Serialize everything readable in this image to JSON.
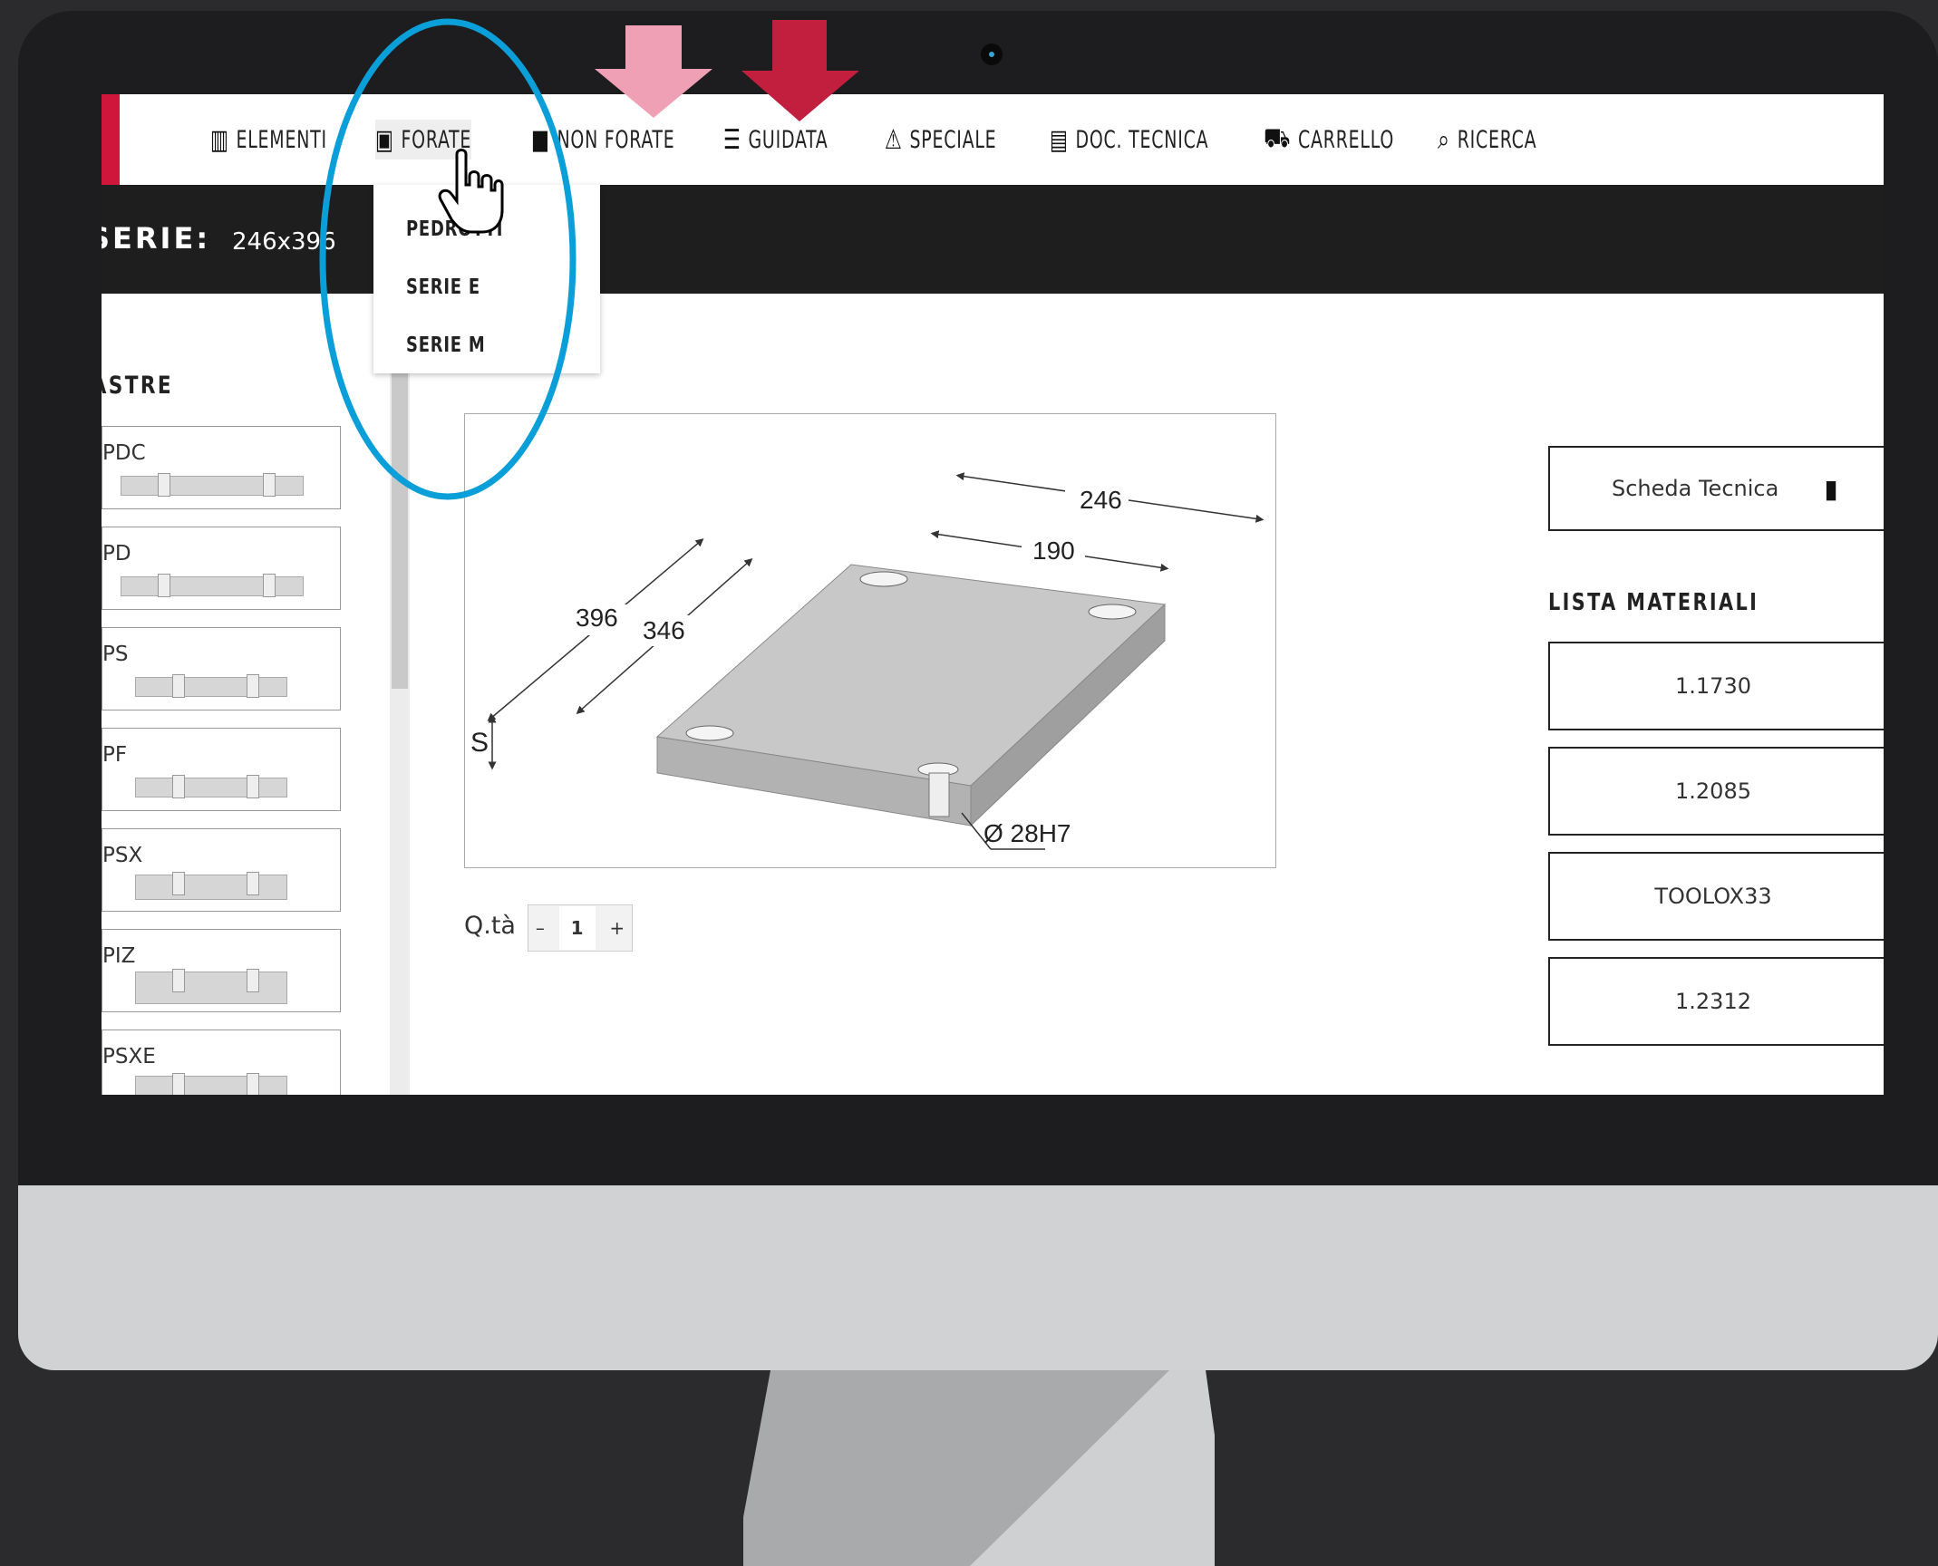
{
  "nav": {
    "items": [
      {
        "label": "ELEMENTI",
        "icon": "bar-chart-icon"
      },
      {
        "label": "FORATE",
        "icon": "drilled-plate-icon"
      },
      {
        "label": "NON FORATE",
        "icon": "solid-plate-icon"
      },
      {
        "label": "GUIDATA",
        "icon": "guided-plate-icon"
      },
      {
        "label": "SPECIALE",
        "icon": "warning-triangle-icon"
      },
      {
        "label": "DOC. TECNICA",
        "icon": "document-icon"
      },
      {
        "label": "CARRELLO",
        "icon": "cart-icon"
      },
      {
        "label": "RICERCA",
        "icon": "search-icon"
      }
    ],
    "dropdown": [
      "PEDROTTI",
      "SERIE E",
      "SERIE M"
    ]
  },
  "series": {
    "label": "SERIE:",
    "value": "246x396"
  },
  "sidebar": {
    "title": "PIASTRE",
    "items": [
      "PDC",
      "PD",
      "PS",
      "PF",
      "PSX",
      "PIZ",
      "PSXE"
    ]
  },
  "drawing": {
    "dims": {
      "length": "246",
      "inner_length": "190",
      "width": "396",
      "inner_width": "346",
      "thickness": "S",
      "hole": "Ø 28H7"
    }
  },
  "quantity": {
    "label": "Q.tà",
    "value": "1",
    "minus": "–",
    "plus": "+"
  },
  "tech_sheet": {
    "label": "Scheda Tecnica",
    "icon": "file-icon"
  },
  "materials": {
    "title": "LISTA MATERIALI",
    "items": [
      "1.1730",
      "1.2085",
      "TOOLOX33",
      "1.2312"
    ]
  },
  "colors": {
    "brand_red": "#d1163c",
    "arrow_pink": "#f0a0b4",
    "arrow_dark_red": "#c21e3e",
    "highlight_blue": "#0a9fd8"
  }
}
